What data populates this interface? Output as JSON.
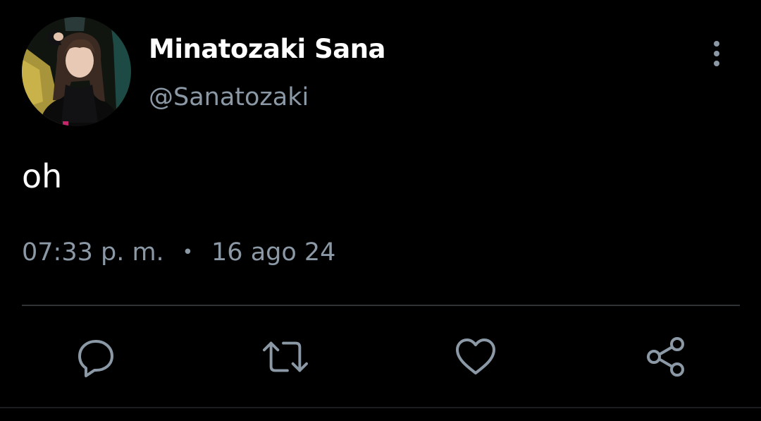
{
  "tweet": {
    "author": {
      "display_name": "Minatozaki Sana",
      "handle": "@Sanatozaki"
    },
    "text": "oh",
    "time": "07:33 p. m.",
    "separator": "•",
    "date": "16 ago 24"
  },
  "actions": {
    "reply_icon": "speech-bubble-icon",
    "retweet_icon": "retweet-arrows-icon",
    "like_icon": "heart-icon",
    "share_icon": "share-nodes-icon"
  },
  "colors": {
    "background": "#000000",
    "primary_text": "#ffffff",
    "secondary_text": "#8b98a5",
    "icon": "#8b98a5",
    "divider": "#2f3336"
  }
}
